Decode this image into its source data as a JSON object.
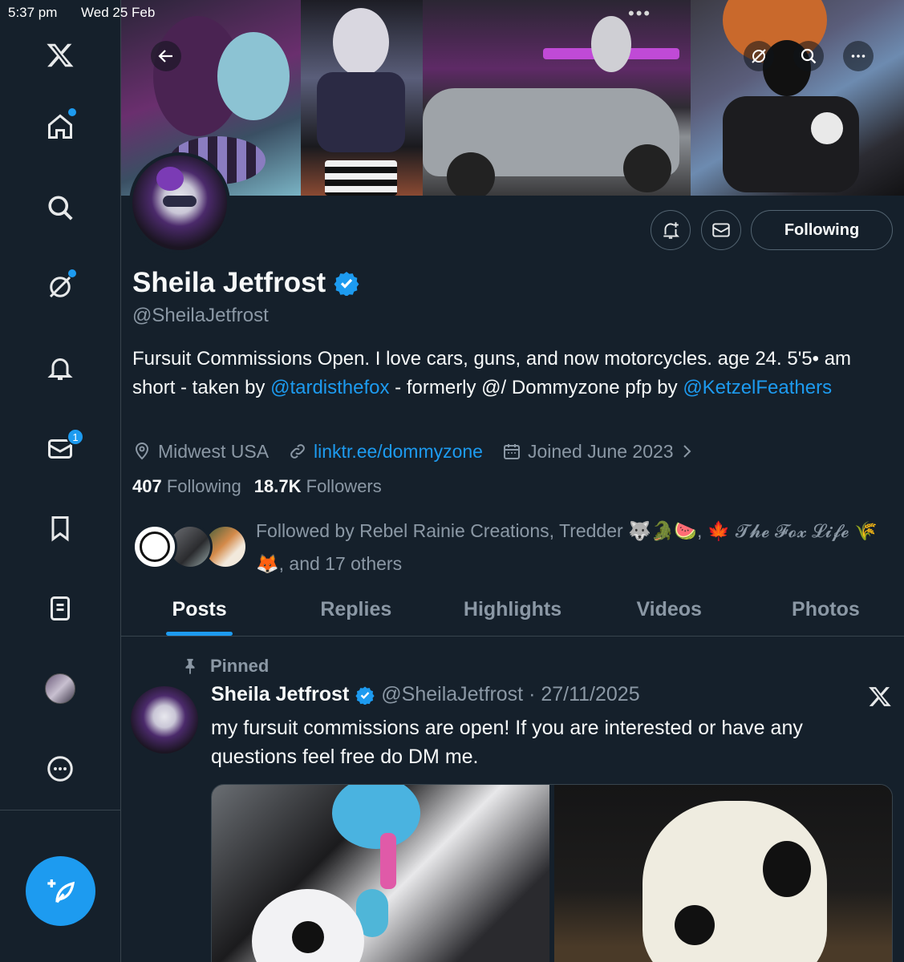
{
  "status_bar": {
    "time": "5:37 pm",
    "date": "Wed 25 Feb",
    "more": "•••"
  },
  "sidebar": {
    "items": [
      {
        "name": "x-logo",
        "icon": "x-logo-icon"
      },
      {
        "name": "home",
        "icon": "home-icon",
        "has_dot": true
      },
      {
        "name": "explore",
        "icon": "search-icon"
      },
      {
        "name": "grok",
        "icon": "grok-icon",
        "has_dot": true
      },
      {
        "name": "notifications",
        "icon": "bell-icon"
      },
      {
        "name": "messages",
        "icon": "mail-icon",
        "badge": "1"
      },
      {
        "name": "bookmarks",
        "icon": "bookmark-icon"
      },
      {
        "name": "lists",
        "icon": "list-icon"
      },
      {
        "name": "profile",
        "icon": "avatar"
      },
      {
        "name": "more",
        "icon": "more-circle-icon"
      }
    ],
    "compose_icon": "compose-icon"
  },
  "colors": {
    "accent": "#1d9bf0",
    "background": "#15202b",
    "muted": "#8b98a5",
    "border": "#38444d"
  },
  "profile": {
    "display_name": "Sheila Jetfrost",
    "handle": "@SheilaJetfrost",
    "verified": true,
    "following_button": "Following",
    "bio": {
      "text1": "Fursuit Commissions Open. I love cars, guns, and now motorcycles. age 24. 5'5• am short - taken by ",
      "mention1": "@tardisthefox",
      "text2": " - formerly @/ Dommyzone pfp by ",
      "mention2": "@KetzelFeathers"
    },
    "location": "Midwest USA",
    "website": "linktr.ee/dommyzone",
    "joined": "Joined June 2023",
    "following_count": "407",
    "following_label": "Following",
    "followers_count": "18.7K",
    "followers_label": "Followers",
    "followed_by": {
      "prefix": "Followed by Rebel Rainie Creations, Tredder 🐺🐊🍉, ",
      "name2": "🍁 𝓣𝓱𝓮 𝓕𝓸𝔁 𝓛𝓲𝓯𝓮",
      "emojis": " 🌾🦊",
      "suffix": ", and 17 others"
    }
  },
  "tabs": [
    "Posts",
    "Replies",
    "Highlights",
    "Videos",
    "Photos"
  ],
  "active_tab": "Posts",
  "pinned_post": {
    "pinned_label": "Pinned",
    "author": "Sheila Jetfrost",
    "handle_date": "@SheilaJetfrost · 27/11/2025",
    "text": "my fursuit commissions are open! If you are interested or have any questions feel free do DM me."
  }
}
